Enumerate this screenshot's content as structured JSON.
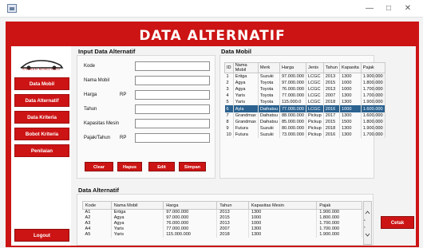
{
  "window": {
    "minimize": "—",
    "maximize": "□",
    "close": "✕"
  },
  "header": {
    "title": "DATA ALTERNATIF"
  },
  "sidebar": {
    "logo_text": "KIRWAN MOBILINDO",
    "items": [
      {
        "label": "Data Mobil"
      },
      {
        "label": "Data Alternatif"
      },
      {
        "label": "Data Kriteria"
      },
      {
        "label": "Bobot Kriteria"
      },
      {
        "label": "Penilaian"
      }
    ],
    "logout": "Logout"
  },
  "form": {
    "title": "Input Data Alternatif",
    "fields": [
      {
        "label": "Kode",
        "prefix": "",
        "value": ""
      },
      {
        "label": "Nama Mobil",
        "prefix": "",
        "value": ""
      },
      {
        "label": "Harga",
        "prefix": "RP",
        "value": ""
      },
      {
        "label": "Tahun",
        "prefix": "",
        "value": ""
      },
      {
        "label": "Kapasitas Mesin",
        "prefix": "",
        "value": ""
      },
      {
        "label": "Pajak/Tahun",
        "prefix": "RP",
        "value": ""
      }
    ],
    "buttons": {
      "clear": "Clear",
      "hapus": "Hapus",
      "edit": "Edit",
      "simpan": "Simpan"
    }
  },
  "mobil_table": {
    "title": "Data Mobil",
    "columns": [
      "ID",
      "Nama Mobil",
      "Merk",
      "Harga",
      "Jenis",
      "Tahun",
      "Kapasita",
      "Pajak"
    ],
    "rows": [
      [
        "1",
        "Ertiga",
        "Suzuki",
        "97.000.000",
        "LCGC",
        "2013",
        "1300",
        "1.900.000"
      ],
      [
        "2",
        "Agya",
        "Toyota",
        "97.000.000",
        "LCGC",
        "2015",
        "1000",
        "1.800.000"
      ],
      [
        "3",
        "Agya",
        "Toyota",
        "76.000.000",
        "LCGC",
        "2013",
        "1000",
        "1.700.000"
      ],
      [
        "4",
        "Yaris",
        "Toyota",
        "77.000.000",
        "LCGC",
        "2007",
        "1300",
        "1.700.000"
      ],
      [
        "5",
        "Yaris",
        "Toyota",
        "115.000.0",
        "LCGC",
        "2018",
        "1300",
        "1.900.000"
      ],
      [
        "6",
        "Ayla",
        "Daihatsu",
        "77.000.000",
        "LCGC",
        "2016",
        "1000",
        "1.600.000"
      ],
      [
        "7",
        "Grandmax",
        "Daihatsu",
        "88.000.000",
        "Pickup",
        "2017",
        "1300",
        "1.600.000"
      ],
      [
        "8",
        "Grandmax",
        "Daihatsu",
        "85.000.000",
        "Pickup",
        "2015",
        "1500",
        "1.800.000"
      ],
      [
        "9",
        "Futura",
        "Suzuki",
        "80.000.000",
        "Pickup",
        "2018",
        "1300",
        "1.900.000"
      ],
      [
        "10",
        "Futura",
        "Suzuki",
        "73.000.000",
        "Pickup",
        "2016",
        "1300",
        "1.700.000"
      ]
    ],
    "selected_row": 5
  },
  "alternatif_table": {
    "title": "Data Alternatif",
    "columns": [
      "Kode",
      "Nama Mobil",
      "Harga",
      "Tahun",
      "Kapasitas Mesin",
      "Pajak"
    ],
    "rows": [
      [
        "A1",
        "Ertiga",
        "97.000.000",
        "2013",
        "1300",
        "1.900.000"
      ],
      [
        "A2",
        "Agya",
        "97.000.000",
        "2015",
        "1000",
        "1.800.000"
      ],
      [
        "A3",
        "Agya",
        "76.000.000",
        "2013",
        "1000",
        "1.700.000"
      ],
      [
        "A4",
        "Yaris",
        "77.000.000",
        "2007",
        "1300",
        "1.700.000"
      ],
      [
        "A5",
        "Yaris",
        "115.000.000",
        "2018",
        "1300",
        "1.900.000"
      ]
    ]
  },
  "actions": {
    "cetak": "Cetak"
  }
}
